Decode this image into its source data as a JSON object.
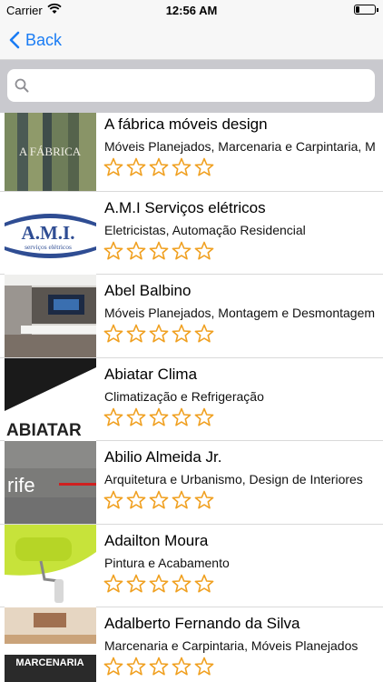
{
  "status": {
    "carrier": "Carrier",
    "time": "12:56 AM"
  },
  "nav": {
    "back_label": "Back"
  },
  "search": {
    "placeholder": "",
    "value": ""
  },
  "colors": {
    "accent": "#1a7cf4",
    "star": "#f0a020"
  },
  "items": [
    {
      "name": "A fábrica móveis design",
      "categories": "Móveis Planejados, Marcenaria e Carpintaria, M",
      "rating": 0,
      "thumb_text": "A FÁBRICA"
    },
    {
      "name": "A.M.I Serviços elétricos",
      "categories": "Eletricistas, Automação Residencial",
      "rating": 0,
      "thumb_text": "A.M.I.",
      "thumb_sub": "serviços elétricos"
    },
    {
      "name": "Abel Balbino",
      "categories": "Móveis Planejados, Montagem e Desmontagem",
      "rating": 0
    },
    {
      "name": "Abiatar Clima",
      "categories": "Climatização e Refrigeração",
      "rating": 0,
      "thumb_text": "ABIATAR"
    },
    {
      "name": "Abilio Almeida Jr.",
      "categories": "Arquitetura e Urbanismo, Design de Interiores",
      "rating": 0,
      "thumb_text": "rife"
    },
    {
      "name": "Adailton Moura",
      "categories": "Pintura e Acabamento",
      "rating": 0
    },
    {
      "name": "Adalberto Fernando da Silva",
      "categories": "Marcenaria e Carpintaria, Móveis Planejados",
      "rating": 0,
      "thumb_text": "MARCENARIA"
    }
  ]
}
